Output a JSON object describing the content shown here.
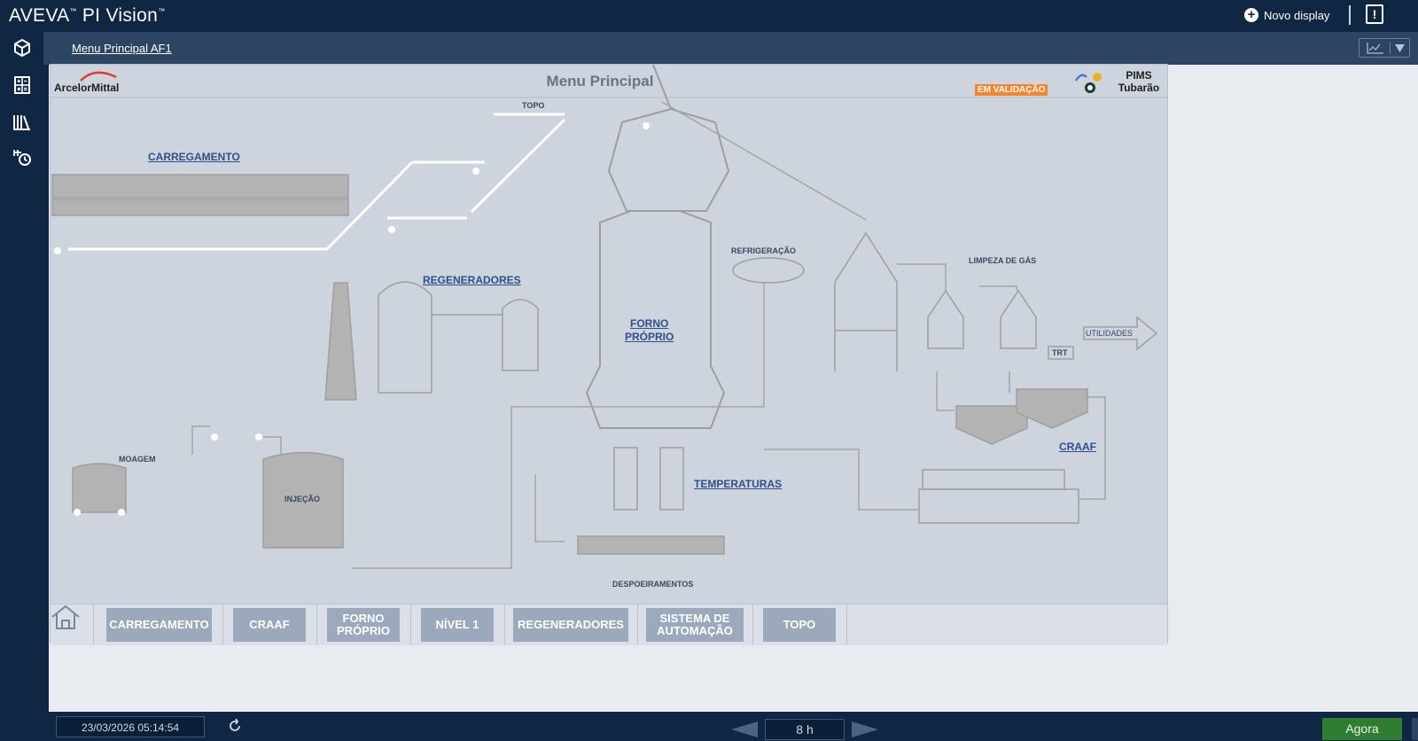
{
  "app": {
    "title_main": "AVEVA",
    "title_sub": "PI Vision",
    "tm": "™"
  },
  "header": {
    "new_display_label": "Novo display"
  },
  "sidebar": {
    "items": [
      "cube-icon",
      "calculator-icon",
      "library-icon",
      "event-timer-icon"
    ]
  },
  "breadcrumb": {
    "current": "Menu Principal AF1"
  },
  "display": {
    "logo": "ArcelorMittal",
    "title": "Menu Principal",
    "status_badge": "EM VALIDAÇÃO",
    "pims_line1": "PIMS",
    "pims_line2": "Tubarão",
    "colors": {
      "badge": "#f5862f",
      "link": "#2f4f8c",
      "equipment": "#b3b3b3",
      "background": "#cdd4de"
    },
    "links": {
      "carregamento": "CARREGAMENTO",
      "regeneradores": "REGENERADORES",
      "forno_line1": "FORNO",
      "forno_line2": "PRÓPRIO",
      "temperaturas": "TEMPERATURAS",
      "craaf": "CRAAF"
    },
    "labels": {
      "topo": "TOPO",
      "refrigeracao": "REFRIGERAÇÃO",
      "limpeza_gas": "LIMPEZA DE GÁS",
      "utilidades": "UTILIDADES",
      "trt": "TRT",
      "moagem": "MOAGEM",
      "injecao": "INJEÇÃO",
      "despoeiramentos": "DESPOEIRAMENTOS"
    },
    "nav": {
      "home_icon": "home-icon",
      "carregamento": "CARREGAMENTO",
      "craaf": "CRAAF",
      "forno_line1": "FORNO",
      "forno_line2": "PRÓPRIO",
      "nivel1": "NÍVEL 1",
      "regeneradores": "REGENERADORES",
      "sistema_line1": "SISTEMA DE",
      "sistema_line2": "AUTOMAÇÃO",
      "topo": "TOPO"
    }
  },
  "timebar": {
    "end_time": "23/03/2026 05:14:54",
    "duration": "8 h",
    "now_label": "Agora",
    "colors": {
      "now_button": "#2e7d32"
    }
  }
}
